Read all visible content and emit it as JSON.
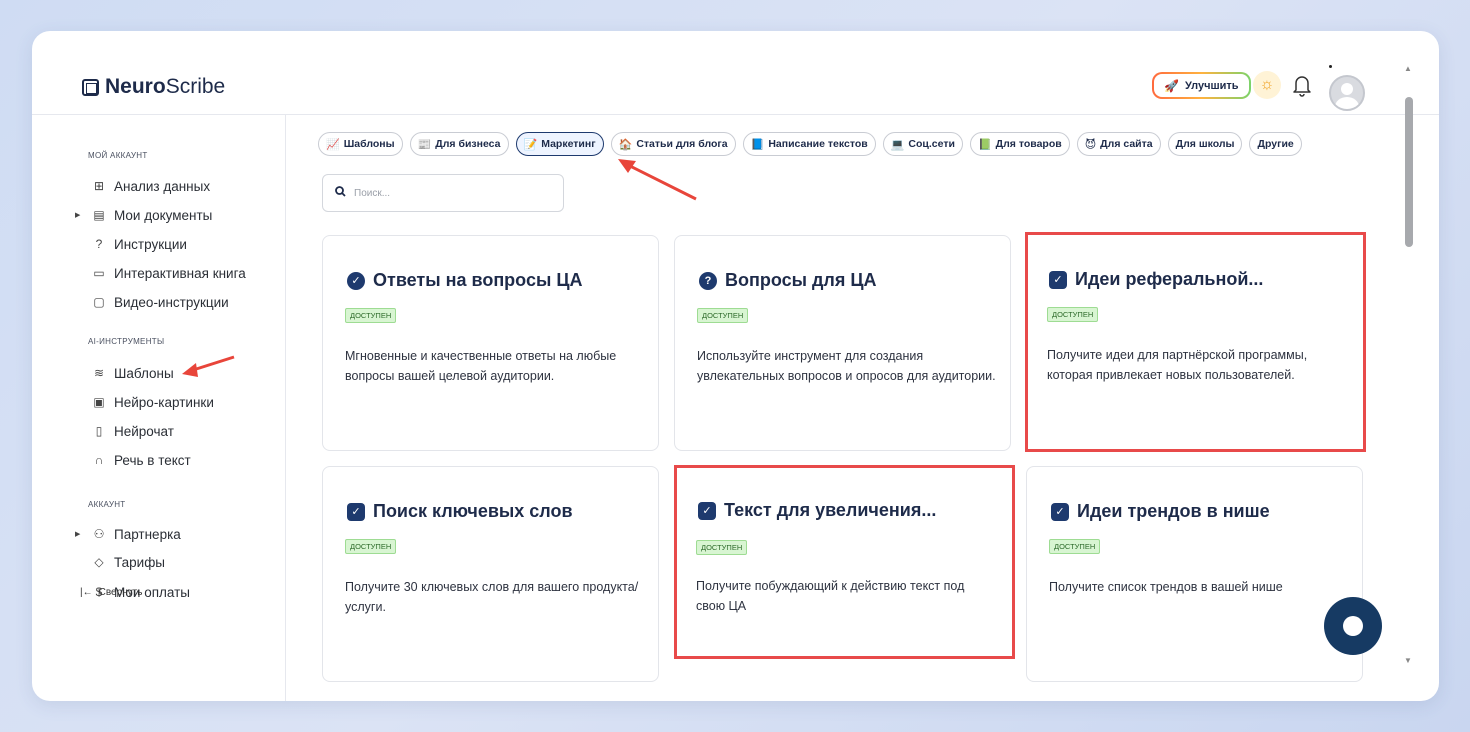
{
  "app": {
    "logo_bold": "Neuro",
    "logo_rest": "Scribe"
  },
  "header": {
    "upgrade_label": "Улучшить"
  },
  "sidebar": {
    "sections": [
      {
        "label": "Мой аккаунт"
      },
      {
        "label": "AI-инструменты"
      },
      {
        "label": "Аккаунт"
      }
    ],
    "items": [
      {
        "label": "Анализ данных",
        "icon": "grid-icon"
      },
      {
        "label": "Мои документы",
        "icon": "document-icon"
      },
      {
        "label": "Инструкции",
        "icon": "help-circle-icon"
      },
      {
        "label": "Интерактивная книга",
        "icon": "book-icon"
      },
      {
        "label": "Видео-инструкции",
        "icon": "video-icon"
      },
      {
        "label": "Шаблоны",
        "icon": "layers-icon"
      },
      {
        "label": "Нейро-картинки",
        "icon": "image-icon"
      },
      {
        "label": "Нейрочат",
        "icon": "chat-icon"
      },
      {
        "label": "Речь в текст",
        "icon": "headphones-icon"
      },
      {
        "label": "Партнерка",
        "icon": "users-icon"
      },
      {
        "label": "Тарифы",
        "icon": "tag-icon"
      },
      {
        "label": "Мои оплаты",
        "icon": "dollar-icon"
      }
    ],
    "collapse_label": "Свернуть"
  },
  "filters": [
    {
      "label": "Шаблоны",
      "icon": "📈"
    },
    {
      "label": "Для бизнеса",
      "icon": "📰"
    },
    {
      "label": "Маркетинг",
      "icon": "📝",
      "active": true
    },
    {
      "label": "Статьи для блога",
      "icon": "🏠"
    },
    {
      "label": "Написание текстов",
      "icon": "📘"
    },
    {
      "label": "Соц.сети",
      "icon": "💻"
    },
    {
      "label": "Для товаров",
      "icon": "📗"
    },
    {
      "label": "Для сайта",
      "icon": "😈"
    },
    {
      "label": "Для школы",
      "icon": ""
    },
    {
      "label": "Другие",
      "icon": ""
    }
  ],
  "search": {
    "placeholder": "Поиск..."
  },
  "cards": [
    {
      "title": "Ответы на вопросы ЦА",
      "badge": "доступен",
      "description": "Мгновенные и качественные ответы на любые вопросы вашей целевой аудитории.",
      "icon": "check-circle-icon"
    },
    {
      "title": "Вопросы для ЦА",
      "badge": "доступен",
      "description": "Используйте инструмент для создания увлекательных вопросов и опросов для аудитории.",
      "icon": "question-circle-icon"
    },
    {
      "title": "Идеи реферальной...",
      "badge": "доступен",
      "description": "Получите идеи для партнёрской программы, которая привлекает новых пользователей.",
      "icon": "check-box-icon"
    },
    {
      "title": "Поиск ключевых слов",
      "badge": "доступен",
      "description": "Получите 30 ключевых слов для вашего продукта/услуги.",
      "icon": "check-box-icon"
    },
    {
      "title": "Текст для увеличения...",
      "badge": "доступен",
      "description": "Получите побуждающий к действию текст под свою ЦА",
      "icon": "check-box-icon"
    },
    {
      "title": "Идеи трендов в нише",
      "badge": "доступен",
      "description": "Получите список трендов в вашей нише",
      "icon": "check-box-icon"
    }
  ],
  "colors": {
    "accent": "#1e3a6e",
    "highlight": "#e84a4a",
    "badge_bg": "#d8f5d2"
  }
}
